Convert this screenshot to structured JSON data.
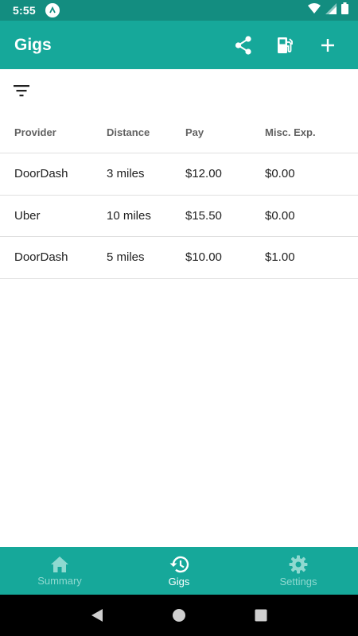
{
  "status_bar": {
    "time": "5:55"
  },
  "app_bar": {
    "title": "Gigs",
    "actions": [
      "share-icon",
      "gas-station-icon",
      "add-icon"
    ]
  },
  "filter": {
    "icon": "filter-icon"
  },
  "table": {
    "headers": [
      "Provider",
      "Distance",
      "Pay",
      "Misc. Exp."
    ],
    "rows": [
      [
        "DoorDash",
        "3 miles",
        "$12.00",
        "$0.00"
      ],
      [
        "Uber",
        "10 miles",
        "$15.50",
        "$0.00"
      ],
      [
        "DoorDash",
        "5 miles",
        "$10.00",
        "$1.00"
      ]
    ]
  },
  "bottom_nav": {
    "items": [
      {
        "label": "Summary",
        "icon": "home-icon",
        "active": false
      },
      {
        "label": "Gigs",
        "icon": "history-icon",
        "active": true
      },
      {
        "label": "Settings",
        "icon": "settings-icon",
        "active": false
      }
    ]
  },
  "colors": {
    "primary": "#16a89a",
    "primary_dark": "#138d80",
    "inactive_nav": "#8fd9d0"
  }
}
